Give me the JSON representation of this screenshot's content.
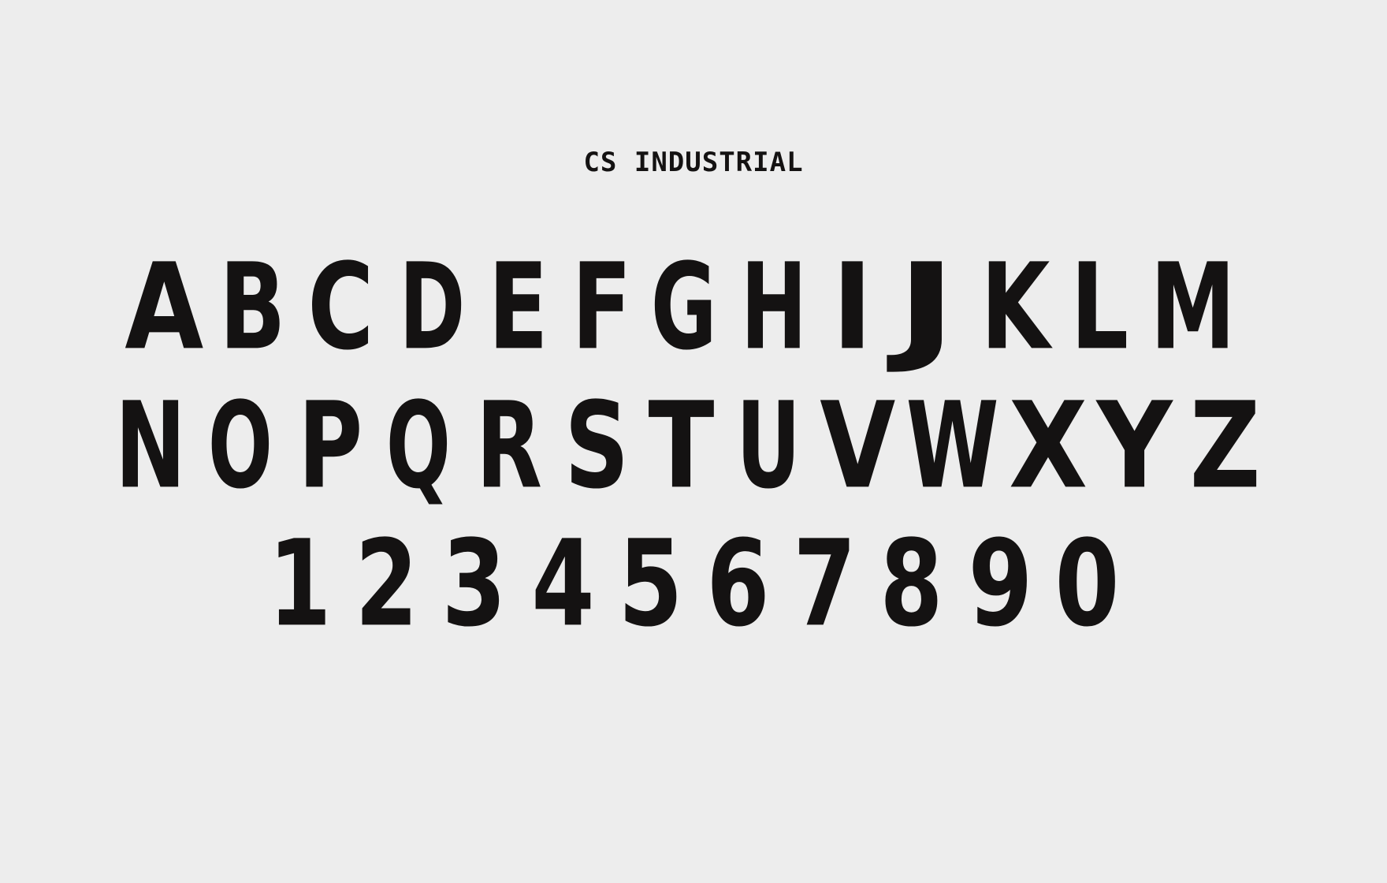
{
  "title": "CS INDUSTRIAL",
  "uppercase_row_1": [
    "A",
    "B",
    "C",
    "D",
    "E",
    "F",
    "G",
    "H",
    "I",
    "J",
    "K",
    "L",
    "M"
  ],
  "uppercase_row_2": [
    "N",
    "O",
    "P",
    "Q",
    "R",
    "S",
    "T",
    "U",
    "V",
    "W",
    "X",
    "Y",
    "Z"
  ],
  "numerals": [
    "1",
    "2",
    "3",
    "4",
    "5",
    "6",
    "7",
    "8",
    "9",
    "0"
  ]
}
